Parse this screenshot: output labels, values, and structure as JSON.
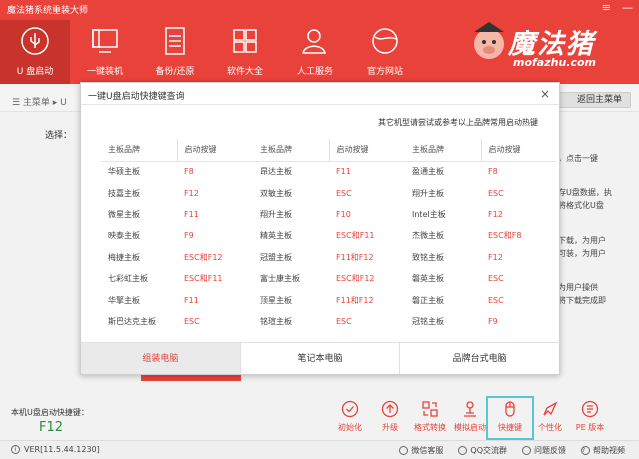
{
  "app": {
    "title": "魔法猪系统重装大师",
    "minimize": "≡",
    "dash": "—",
    "close": "✕"
  },
  "nav": [
    {
      "label": "U 盘启动",
      "icon": "usb-icon"
    },
    {
      "label": "一键装机",
      "icon": "computer-icon"
    },
    {
      "label": "备份/还原",
      "icon": "document-icon"
    },
    {
      "label": "软件大全",
      "icon": "grid-icon"
    },
    {
      "label": "人工服务",
      "icon": "user-service-icon"
    },
    {
      "label": "官方网站",
      "icon": "globe-icon"
    }
  ],
  "logo": {
    "cn": "魔法猪",
    "en": "mofazhu.com"
  },
  "breadcrumb": {
    "text": "☰ 主菜单 ▸ U",
    "back": "返回主菜单"
  },
  "select_label": "选择：",
  "side_texts": [
    "，点击一键",
    "存U盘数据，执",
    "将格式化U盘",
    "下载，为用户",
    "可装，为用户",
    "为用户操供",
    "将下载完成即"
  ],
  "dialog": {
    "title": "一键U盘启动快捷键查询",
    "note": "其它机型请尝试或参考以上品牌常用启动热键",
    "headers": [
      "主板品牌",
      "启动按键",
      "主板品牌",
      "启动按键",
      "主板品牌",
      "启动按键"
    ],
    "rows": [
      [
        "华硕主板",
        "F8",
        "昂达主板",
        "F11",
        "盈通主板",
        "F8"
      ],
      [
        "技嘉主板",
        "F12",
        "双敏主板",
        "ESC",
        "翔升主板",
        "ESC"
      ],
      [
        "微星主板",
        "F11",
        "翔升主板",
        "F10",
        "Intel主板",
        "F12"
      ],
      [
        "映泰主板",
        "F9",
        "精英主板",
        "ESC和F11",
        "杰微主板",
        "ESC和F8"
      ],
      [
        "梅捷主板",
        "ESC和F12",
        "冠盟主板",
        "F11和F12",
        "致铭主板",
        "F12"
      ],
      [
        "七彩虹主板",
        "ESC和F11",
        "富士康主板",
        "ESC和F12",
        "磐英主板",
        "ESC"
      ],
      [
        "华擎主板",
        "F11",
        "顶星主板",
        "F11和F12",
        "磐正主板",
        "ESC"
      ],
      [
        "斯巴达克主板",
        "ESC",
        "铭瑄主板",
        "ESC",
        "冠铭主板",
        "F9"
      ]
    ],
    "tabs": [
      "组装电脑",
      "笔记本电脑",
      "品牌台式电脑"
    ],
    "close": "×"
  },
  "bottom": {
    "hotkey_label": "本机U盘启动快捷键：",
    "hotkey_value": "F12"
  },
  "tools": [
    {
      "label": "初始化",
      "icon": "check-circle-icon"
    },
    {
      "label": "升级",
      "icon": "upload-icon"
    },
    {
      "label": "格式转换",
      "icon": "convert-icon"
    },
    {
      "label": "模拟启动",
      "icon": "simulate-icon"
    },
    {
      "label": "快捷键",
      "icon": "mouse-icon"
    },
    {
      "label": "个性化",
      "icon": "brush-icon"
    },
    {
      "label": "PE 版本",
      "icon": "pe-icon"
    }
  ],
  "status": {
    "version": "VER[11.5.44.1230]",
    "links": [
      "微信客服",
      "QQ交流群",
      "问题反馈",
      "帮助视频"
    ]
  },
  "colors": {
    "brand": "#e8423a",
    "highlight": "#5bc5d6",
    "hotkey": "#2f8a3b"
  }
}
